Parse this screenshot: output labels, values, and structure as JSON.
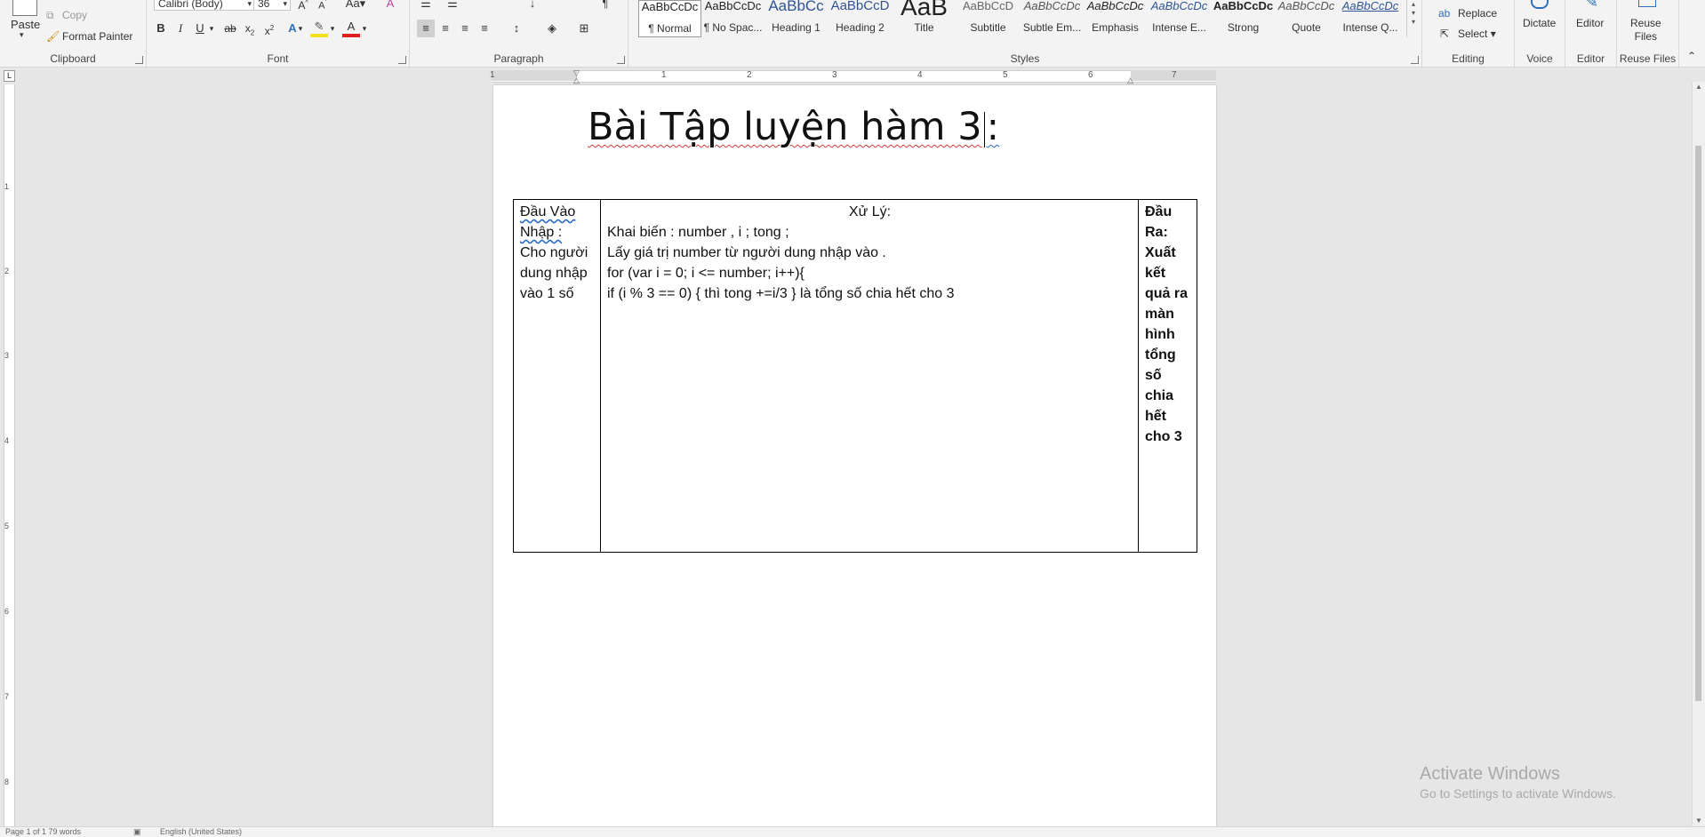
{
  "ribbon": {
    "clipboard": {
      "label": "Clipboard",
      "paste": "Paste",
      "copy": "Copy",
      "format_painter": "Format Painter"
    },
    "font": {
      "label": "Font",
      "family": "Calibri (Body)",
      "size": "36"
    },
    "paragraph": {
      "label": "Paragraph"
    },
    "styles": {
      "label": "Styles",
      "items": [
        {
          "preview": "AaBbCcDc",
          "name": "¶ Normal"
        },
        {
          "preview": "AaBbCcDc",
          "name": "¶ No Spac..."
        },
        {
          "preview": "AaBbCc",
          "name": "Heading 1"
        },
        {
          "preview": "AaBbCcD",
          "name": "Heading 2"
        },
        {
          "preview": "AaB",
          "name": "Title"
        },
        {
          "preview": "AaBbCcD",
          "name": "Subtitle"
        },
        {
          "preview": "AaBbCcDc",
          "name": "Subtle Em..."
        },
        {
          "preview": "AaBbCcDc",
          "name": "Emphasis"
        },
        {
          "preview": "AaBbCcDc",
          "name": "Intense E..."
        },
        {
          "preview": "AaBbCcDc",
          "name": "Strong"
        },
        {
          "preview": "AaBbCcDc",
          "name": "Quote"
        },
        {
          "preview": "AaBbCcDc",
          "name": "Intense Q..."
        }
      ]
    },
    "editing": {
      "label": "Editing",
      "replace": "Replace",
      "select": "Select"
    },
    "voice": {
      "label": "Voice",
      "dictate": "Dictate"
    },
    "editor": {
      "label": "Editor",
      "editor": "Editor"
    },
    "reuse": {
      "label": "Reuse Files",
      "reuse_line1": "Reuse",
      "reuse_line2": "Files"
    }
  },
  "ruler": {
    "h_numbers": [
      "1",
      "1",
      "2",
      "3",
      "4",
      "5",
      "6",
      "7"
    ],
    "v_numbers": [
      "1",
      "2",
      "3",
      "4",
      "5",
      "6",
      "7",
      "8"
    ]
  },
  "document": {
    "title_pre": "Bài Tập luyện hàm 3",
    "title_post": ":",
    "table": {
      "col1": {
        "heading": "Đầu Vào Nhập :",
        "body": "Cho người dung nhập vào 1 số"
      },
      "col2": {
        "heading": "Xử Lý:",
        "lines": [
          "Khai biến : number , i ; tong ;",
          "Lấy giá trị number từ người dung nhập vào .",
          "for (var i = 0; i <= number; i++){",
          " if (i % 3 == 0) { thì tong +=i/3 } là tổng số chia hết cho 3"
        ]
      },
      "col3": {
        "heading": "Đầu Ra:",
        "body": "Xuất kết quả ra màn hình tổng số chia hết cho 3"
      }
    }
  },
  "watermark": {
    "title": "Activate Windows",
    "subtitle": "Go to Settings to activate Windows."
  },
  "statusbar": {
    "words": "Page 1 of 1   79 words",
    "language": "English (United States)"
  }
}
